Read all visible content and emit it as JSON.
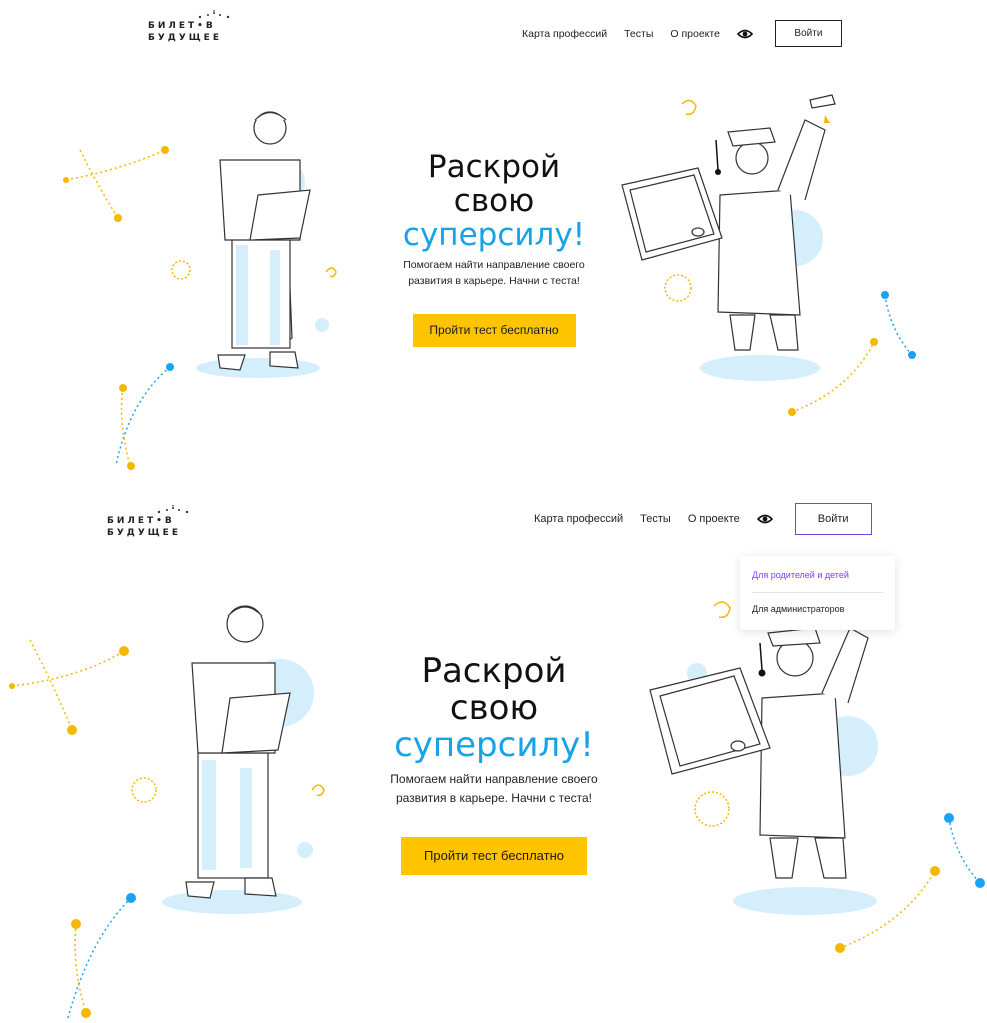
{
  "logo": {
    "line1": "БИЛЕТ•В",
    "line2": "БУДУЩЕЕ"
  },
  "nav": {
    "items": [
      "Карта профессий",
      "Тесты",
      "О проекте"
    ],
    "accessibility_icon": "eye-icon",
    "login_label": "Войти"
  },
  "hero": {
    "line1": "Раскрой",
    "line2": "свою",
    "accent": "суперсилу!",
    "subtitle_line1": "Помогаем найти направление своего",
    "subtitle_line2": "развития в карьере. Начни с теста!",
    "cta_label": "Пройти тест бесплатно"
  },
  "dropdown": {
    "options": [
      "Для родителей и детей",
      "Для администраторов"
    ]
  },
  "colors": {
    "accent_blue": "#16a3e8",
    "cta_yellow": "#ffc400",
    "light_blue": "#d4eefc",
    "dot_yellow": "#f5b800",
    "dot_blue": "#1aa3f0",
    "dropdown_active": "#7b3ff2"
  }
}
